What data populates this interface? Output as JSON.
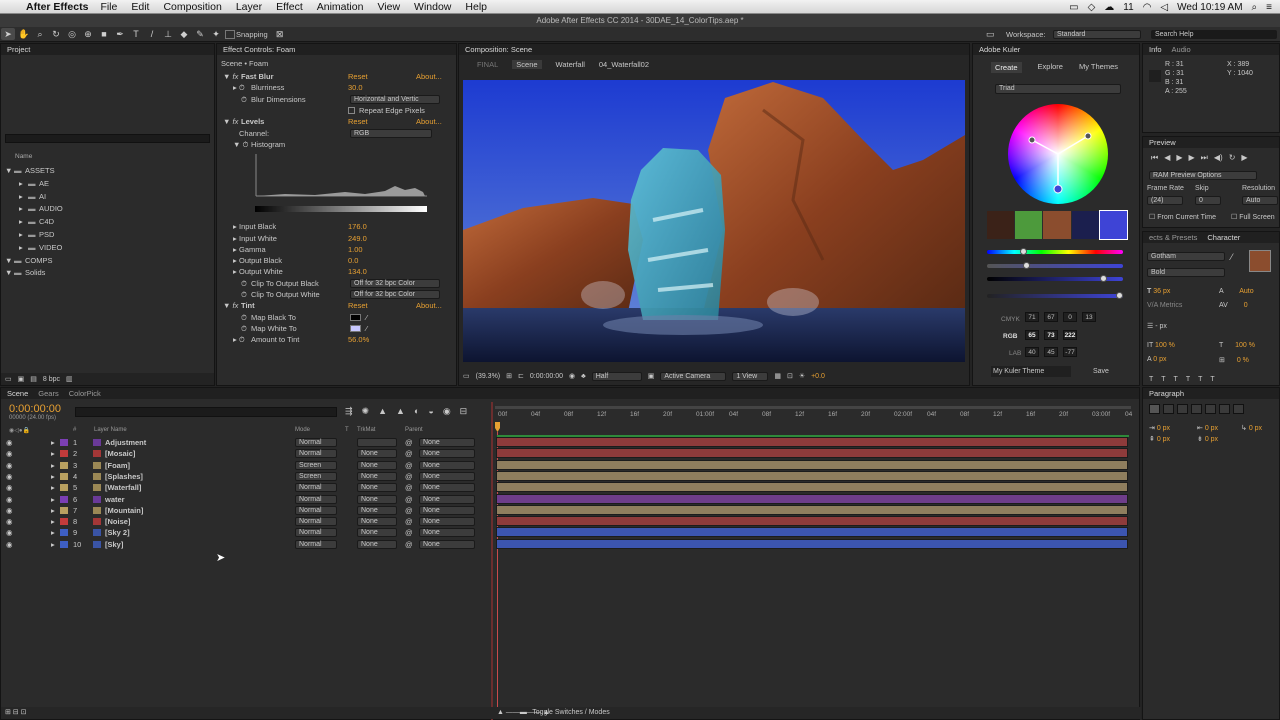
{
  "menubar": {
    "app": "After Effects",
    "items": [
      "File",
      "Edit",
      "Composition",
      "Layer",
      "Effect",
      "Animation",
      "View",
      "Window",
      "Help"
    ],
    "battery": "11",
    "time": "Wed 10:19 AM"
  },
  "window": {
    "title": "Adobe After Effects CC 2014 - 30DAE_14_ColorTips.aep *"
  },
  "toolbar": {
    "snapping": "Snapping",
    "workspace_label": "Workspace:",
    "workspace_value": "Standard",
    "search_placeholder": "Search Help"
  },
  "project": {
    "tab": "Project",
    "name_col": "Name",
    "tree": [
      {
        "label": "ASSETS",
        "indent": 0
      },
      {
        "label": "AE",
        "indent": 1
      },
      {
        "label": "AI",
        "indent": 1
      },
      {
        "label": "AUDIO",
        "indent": 1
      },
      {
        "label": "C4D",
        "indent": 1
      },
      {
        "label": "PSD",
        "indent": 1
      },
      {
        "label": "VIDEO",
        "indent": 1
      },
      {
        "label": "COMPS",
        "indent": 0
      },
      {
        "label": "Solids",
        "indent": 0
      }
    ],
    "bpc": "8 bpc"
  },
  "effects": {
    "tab": "Effect Controls: Foam",
    "subtitle": "Scene • Foam",
    "fast_blur": {
      "name": "Fast Blur",
      "reset": "Reset",
      "about": "About...",
      "blurriness_label": "Blurriness",
      "blurriness": "30.0",
      "dims_label": "Blur Dimensions",
      "dims": "Horizontal and Vertic",
      "repeat": "Repeat Edge Pixels"
    },
    "levels": {
      "name": "Levels",
      "reset": "Reset",
      "about": "About...",
      "channel_label": "Channel:",
      "channel": "RGB",
      "histogram": "Histogram",
      "input_black_label": "Input Black",
      "input_black": "176.0",
      "input_white_label": "Input White",
      "input_white": "249.0",
      "gamma_label": "Gamma",
      "gamma": "1.00",
      "output_black_label": "Output Black",
      "output_black": "0.0",
      "output_white_label": "Output White",
      "output_white": "134.0",
      "clip_black_label": "Clip To Output Black",
      "clip_black": "Off for 32 bpc Color",
      "clip_white_label": "Clip To Output White",
      "clip_white": "Off for 32 bpc Color"
    },
    "tint": {
      "name": "Tint",
      "reset": "Reset",
      "about": "About...",
      "map_black": "Map Black To",
      "map_white": "Map White To",
      "amount_label": "Amount to Tint",
      "amount": "56.0%"
    }
  },
  "comp": {
    "tab": "Composition: Scene",
    "breadcrumbs": [
      "FINAL",
      "Scene",
      "Waterfall",
      "04_Waterfall02"
    ],
    "zoom": "(39.3%)",
    "timecode": "0:00:00:00",
    "resolution": "Half",
    "camera": "Active Camera",
    "views": "1 View",
    "exposure": "+0.0"
  },
  "kuler": {
    "tab": "Adobe Kuler",
    "tabs": [
      "Create",
      "Explore",
      "My Themes"
    ],
    "rule": "Triad",
    "swatches": [
      "#3b2218",
      "#4d9a3c",
      "#8b4d2e",
      "#1b1f4e",
      "#3e44d6"
    ],
    "cmyk_label": "CMYK",
    "cmyk": [
      "71",
      "67",
      "0",
      "13"
    ],
    "rgb_label": "RGB",
    "rgb": [
      "65",
      "73",
      "222"
    ],
    "lab_label": "LAB",
    "lab": [
      "40",
      "45",
      "-77"
    ],
    "theme_name": "My Kuler Theme",
    "save": "Save"
  },
  "info": {
    "tabs": [
      "Info",
      "Audio"
    ],
    "r": "R : 31",
    "g": "G : 31",
    "b": "B : 31",
    "a": "A : 255",
    "x": "X : 389",
    "y": "Y : 1040"
  },
  "preview": {
    "tab": "Preview",
    "ram": "RAM Preview Options",
    "frame_rate_label": "Frame Rate",
    "skip_label": "Skip",
    "resolution_label": "Resolution",
    "frame_rate": "(24)",
    "skip": "0",
    "resolution": "Auto",
    "from_current": "From Current Time",
    "full_screen": "Full Screen"
  },
  "character": {
    "tabs": [
      "ects & Presets",
      "Character"
    ],
    "font": "Gotham",
    "style": "Bold",
    "size": "36 px",
    "leading": "Auto",
    "metrics": "Metrics",
    "tracking": "0",
    "stroke": "- px",
    "vscale": "100 %",
    "hscale": "100 %",
    "baseline": "0 px",
    "tsume": "0 %"
  },
  "paragraph": {
    "tab": "Paragraph",
    "indent_left": "0 px",
    "indent_right": "0 px",
    "indent_first": "0 px",
    "space_before": "0 px",
    "space_after": "0 px"
  },
  "timeline": {
    "tabs": [
      "Scene",
      "Gears",
      "ColorPick"
    ],
    "timecode": "0:00:00:00",
    "fps": "00000 (24.00 fps)",
    "cols": {
      "num": "#",
      "name": "Layer Name",
      "mode": "Mode",
      "t": "T",
      "trkmat": "TrkMat",
      "parent": "Parent"
    },
    "ruler": [
      "00f",
      "04f",
      "08f",
      "12f",
      "16f",
      "20f",
      "01:00f",
      "04f",
      "08f",
      "12f",
      "16f",
      "20f",
      "02:00f",
      "04f",
      "08f",
      "12f",
      "16f",
      "20f",
      "03:00f",
      "04"
    ],
    "layers": [
      {
        "num": "1",
        "name": "Adjustment",
        "mode": "Normal",
        "trkmat": "",
        "parent": "None",
        "color": "#7b3fb4",
        "bar": "#8e3b3b"
      },
      {
        "num": "2",
        "name": "[Mosaic]",
        "mode": "Normal",
        "trkmat": "None",
        "parent": "None",
        "color": "#c23b3b",
        "bar": "#8e3b3b"
      },
      {
        "num": "3",
        "name": "[Foam]",
        "mode": "Screen",
        "trkmat": "None",
        "parent": "None",
        "color": "#b8a060",
        "bar": "#8f7e5e"
      },
      {
        "num": "4",
        "name": "[Splashes]",
        "mode": "Screen",
        "trkmat": "None",
        "parent": "None",
        "color": "#b8a060",
        "bar": "#8f7e5e"
      },
      {
        "num": "5",
        "name": "[Waterfall]",
        "mode": "Normal",
        "trkmat": "None",
        "parent": "None",
        "color": "#b8a060",
        "bar": "#8f7e5e"
      },
      {
        "num": "6",
        "name": "water",
        "mode": "Normal",
        "trkmat": "None",
        "parent": "None",
        "color": "#7b3fb4",
        "bar": "#6e3d8a"
      },
      {
        "num": "7",
        "name": "[Mountain]",
        "mode": "Normal",
        "trkmat": "None",
        "parent": "None",
        "color": "#b8a060",
        "bar": "#8f7e5e"
      },
      {
        "num": "8",
        "name": "[Noise]",
        "mode": "Normal",
        "trkmat": "None",
        "parent": "None",
        "color": "#c23b3b",
        "bar": "#8e3b3b"
      },
      {
        "num": "9",
        "name": "[Sky 2]",
        "mode": "Normal",
        "trkmat": "None",
        "parent": "None",
        "color": "#3e5fc4",
        "bar": "#3c55b0"
      },
      {
        "num": "10",
        "name": "[Sky]",
        "mode": "Normal",
        "trkmat": "None",
        "parent": "None",
        "color": "#3e5fc4",
        "bar": "#3c55b0"
      }
    ],
    "toggle": "Toggle Switches / Modes"
  }
}
